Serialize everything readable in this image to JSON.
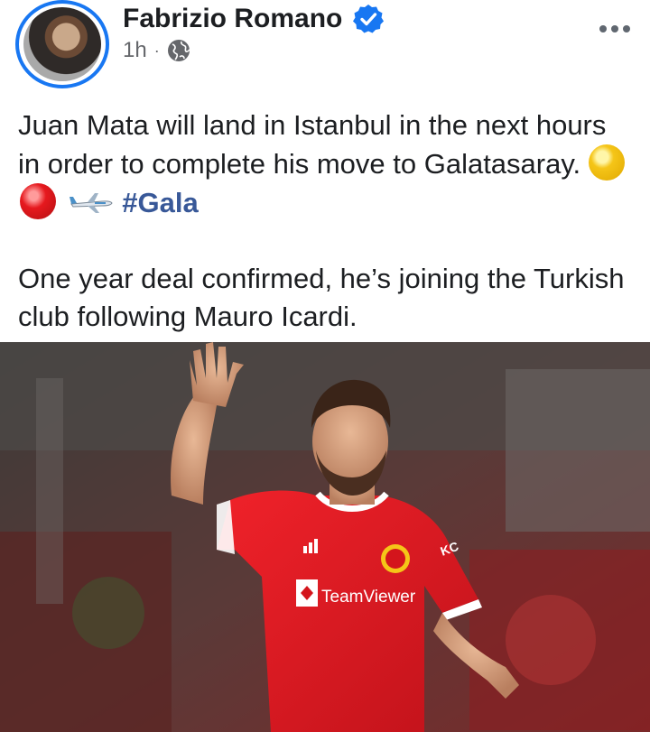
{
  "post": {
    "author": "Fabrizio Romano",
    "time": "1h",
    "separator": "·",
    "text_line1": "Juan Mata will land in Istanbul in the next hours in order to complete his move to Galatasaray.",
    "hashtag": "#Gala",
    "text_line2": "One year deal confirmed, he’s joining the Turkish club following Mauro Icardi."
  },
  "photo": {
    "sponsor": "TeamViewer",
    "kit_brand": "adidas",
    "sleeve_text": "KC"
  },
  "colors": {
    "verified": "#1877f2",
    "hashtag": "#385898",
    "shirt": "#e0161f"
  },
  "icons": [
    "verified-badge-icon",
    "globe-icon",
    "more-options-icon",
    "yellow-circle-emoji",
    "red-circle-emoji",
    "airplane-emoji"
  ]
}
